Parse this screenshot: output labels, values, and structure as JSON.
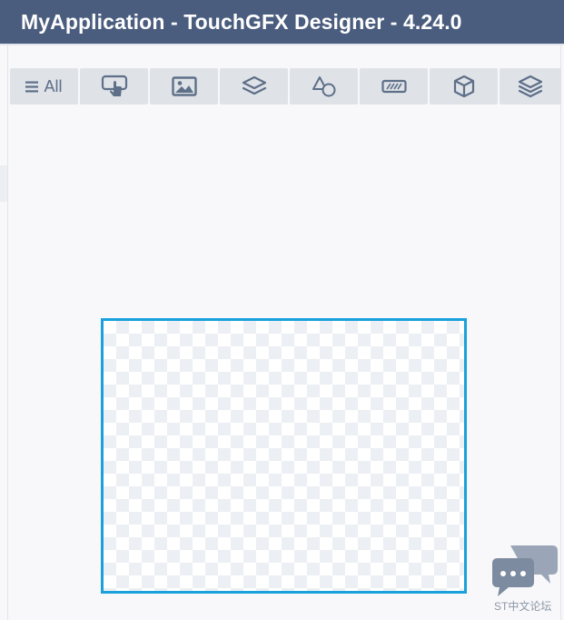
{
  "window": {
    "title": "MyApplication - TouchGFX Designer - 4.24.0"
  },
  "toolbar": {
    "tabs": [
      {
        "label": "All",
        "icon": "hamburger-menu-icon"
      },
      {
        "label": "",
        "icon": "touch-interaction-icon"
      },
      {
        "label": "",
        "icon": "image-icon"
      },
      {
        "label": "",
        "icon": "layers-icon"
      },
      {
        "label": "",
        "icon": "shapes-icon"
      },
      {
        "label": "",
        "icon": "progress-indicator-icon"
      },
      {
        "label": "",
        "icon": "cube-icon"
      },
      {
        "label": "",
        "icon": "layers-stack-icon"
      }
    ]
  },
  "watermark": {
    "text": "ST中文论坛",
    "icon": "chat-bubbles-icon"
  },
  "colors": {
    "titlebar_bg": "#4a5d7e",
    "toolbar_button_bg": "#dfe3e8",
    "icon_color": "#5e6f88",
    "screen_frame_border": "#1aa1dc",
    "canvas_bg": "#f8f8fb"
  }
}
